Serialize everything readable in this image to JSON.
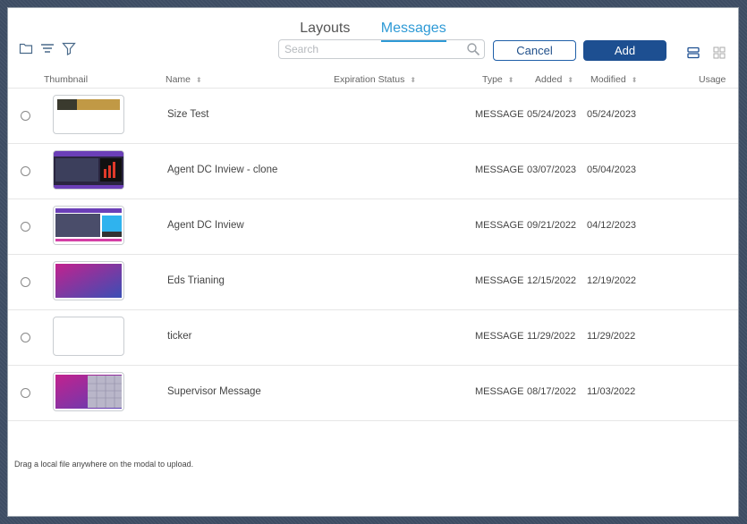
{
  "tabs": [
    {
      "label": "Layouts",
      "active": false
    },
    {
      "label": "Messages",
      "active": true
    }
  ],
  "toolbar": {
    "icons": [
      "folder-icon",
      "sort-icon",
      "filter-icon"
    ],
    "search_placeholder": "Search",
    "cancel_label": "Cancel",
    "add_label": "Add",
    "view_icons": [
      "list-view-icon",
      "grid-view-icon"
    ]
  },
  "table": {
    "columns": {
      "thumbnail": "Thumbnail",
      "name": "Name",
      "expiration_status": "Expiration Status",
      "type": "Type",
      "added": "Added",
      "modified": "Modified",
      "usage": "Usage"
    },
    "rows": [
      {
        "name": "Size Test",
        "type": "MESSAGE",
        "added": "05/24/2023",
        "modified": "05/24/2023",
        "thumb": "size-test"
      },
      {
        "name": "Agent DC Inview - clone",
        "type": "MESSAGE",
        "added": "03/07/2023",
        "modified": "05/04/2023",
        "thumb": "agent-clone"
      },
      {
        "name": "Agent DC Inview",
        "type": "MESSAGE",
        "added": "09/21/2022",
        "modified": "04/12/2023",
        "thumb": "agent"
      },
      {
        "name": "Eds Trianing",
        "type": "MESSAGE",
        "added": "12/15/2022",
        "modified": "12/19/2022",
        "thumb": "eds"
      },
      {
        "name": "ticker",
        "type": "MESSAGE",
        "added": "11/29/2022",
        "modified": "11/29/2022",
        "thumb": "blank"
      },
      {
        "name": "Supervisor Message",
        "type": "MESSAGE",
        "added": "08/17/2022",
        "modified": "11/03/2022",
        "thumb": "supervisor"
      }
    ]
  },
  "footer_note": "Drag a local file anywhere on the modal to upload.",
  "colors": {
    "accent": "#2e9ad6",
    "primary_button": "#1d4f91"
  }
}
